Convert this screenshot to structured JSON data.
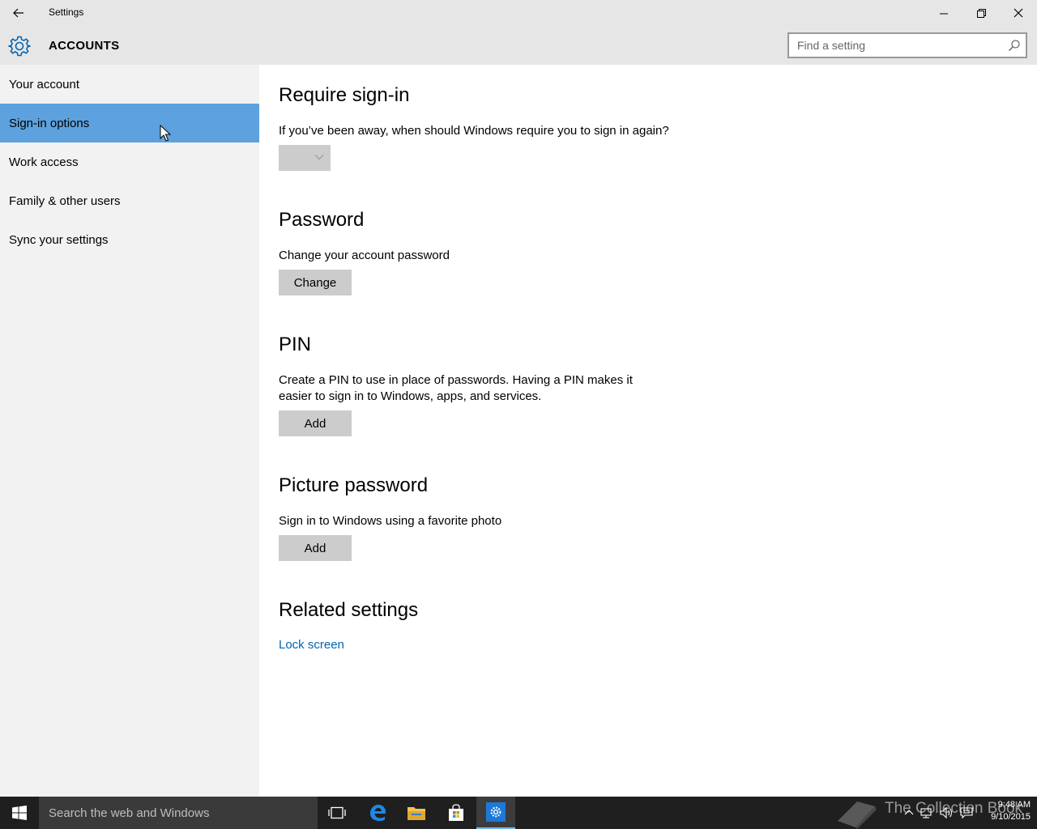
{
  "window": {
    "title": "Settings",
    "back_icon": "back-arrow-icon",
    "controls": [
      "minimize-icon",
      "restore-icon",
      "close-icon"
    ]
  },
  "header": {
    "icon": "gear-icon",
    "title": "ACCOUNTS",
    "search_placeholder": "Find a setting",
    "search_value": ""
  },
  "sidebar": {
    "items": [
      {
        "label": "Your account",
        "selected": false
      },
      {
        "label": "Sign-in options",
        "selected": true
      },
      {
        "label": "Work access",
        "selected": false
      },
      {
        "label": "Family & other users",
        "selected": false
      },
      {
        "label": "Sync your settings",
        "selected": false
      }
    ]
  },
  "main": {
    "require_signin": {
      "heading": "Require sign-in",
      "description": "If you’ve been away, when should Windows require you to sign in again?",
      "dropdown_value": ""
    },
    "password": {
      "heading": "Password",
      "description": "Change your account password",
      "button": "Change"
    },
    "pin": {
      "heading": "PIN",
      "description_line1": "Create a PIN to use in place of passwords. Having a PIN makes it",
      "description_line2": "easier to sign in to Windows, apps, and services.",
      "button": "Add"
    },
    "picture_password": {
      "heading": "Picture password",
      "description": "Sign in to Windows using a favorite photo",
      "button": "Add"
    },
    "related": {
      "heading": "Related settings",
      "link": "Lock screen"
    }
  },
  "taskbar": {
    "search_text": "Search the web and Windows",
    "time": "9:48 AM",
    "date": "9/10/2015",
    "watermark": "The Collection Book"
  },
  "colors": {
    "accent": "#0063b1",
    "selected_nav": "#5da1de",
    "chrome": "#e6e6e6",
    "sidebar": "#f2f2f2",
    "taskbar": "#1f1f1f"
  }
}
